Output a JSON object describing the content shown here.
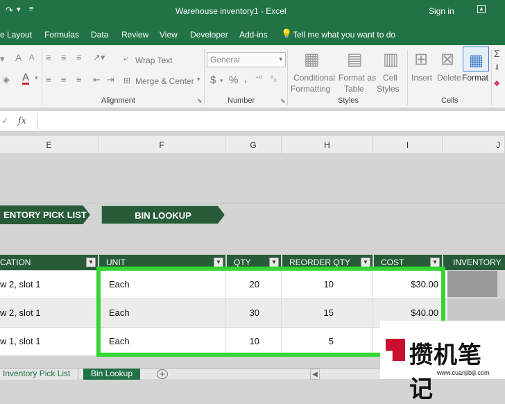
{
  "window": {
    "title": "Warehouse inventory1 - Excel",
    "signin": "Sign in"
  },
  "menu": [
    "e Layout",
    "Formulas",
    "Data",
    "Review",
    "View",
    "Developer",
    "Add-ins"
  ],
  "tellme": "Tell me what you want to do",
  "ribbon": {
    "alignment": {
      "wrap": "Wrap Text",
      "merge": "Merge & Center",
      "label": "Alignment"
    },
    "number": {
      "format": "General",
      "label": "Number"
    },
    "styles": {
      "conditional": [
        "Conditional",
        "Formatting"
      ],
      "table": [
        "Format as",
        "Table"
      ],
      "cell": [
        "Cell",
        "Styles"
      ],
      "label": "Styles"
    },
    "cells": {
      "insert": "Insert",
      "delete": "Delete",
      "format": "Format",
      "label": "Cells"
    }
  },
  "formula": {
    "fx": "fx"
  },
  "columns": [
    "E",
    "F",
    "G",
    "H",
    "I",
    "J"
  ],
  "nav": {
    "pick": "ENTORY PICK LIST",
    "bin": "BIN LOOKUP"
  },
  "table": {
    "headers": [
      "CATION",
      "UNIT",
      "QTY",
      "REORDER QTY",
      "COST",
      "INVENTORY"
    ],
    "rows": [
      {
        "loc": "w 2, slot 1",
        "unit": "Each",
        "qty": "20",
        "reorder": "10",
        "cost": "$30.00"
      },
      {
        "loc": "w 2, slot 1",
        "unit": "Each",
        "qty": "30",
        "reorder": "15",
        "cost": "$40.00"
      },
      {
        "loc": "w 1, slot 1",
        "unit": "Each",
        "qty": "10",
        "reorder": "5",
        "cost": ""
      }
    ]
  },
  "tabs": [
    "Inventory Pick List",
    "Bin Lookup"
  ],
  "watermark": {
    "text": "攒机笔记",
    "url": "www.cuanjibiji.com"
  },
  "colors": {
    "excel_green": "#217346",
    "header_green": "#285c38",
    "selection": "#33d633"
  }
}
